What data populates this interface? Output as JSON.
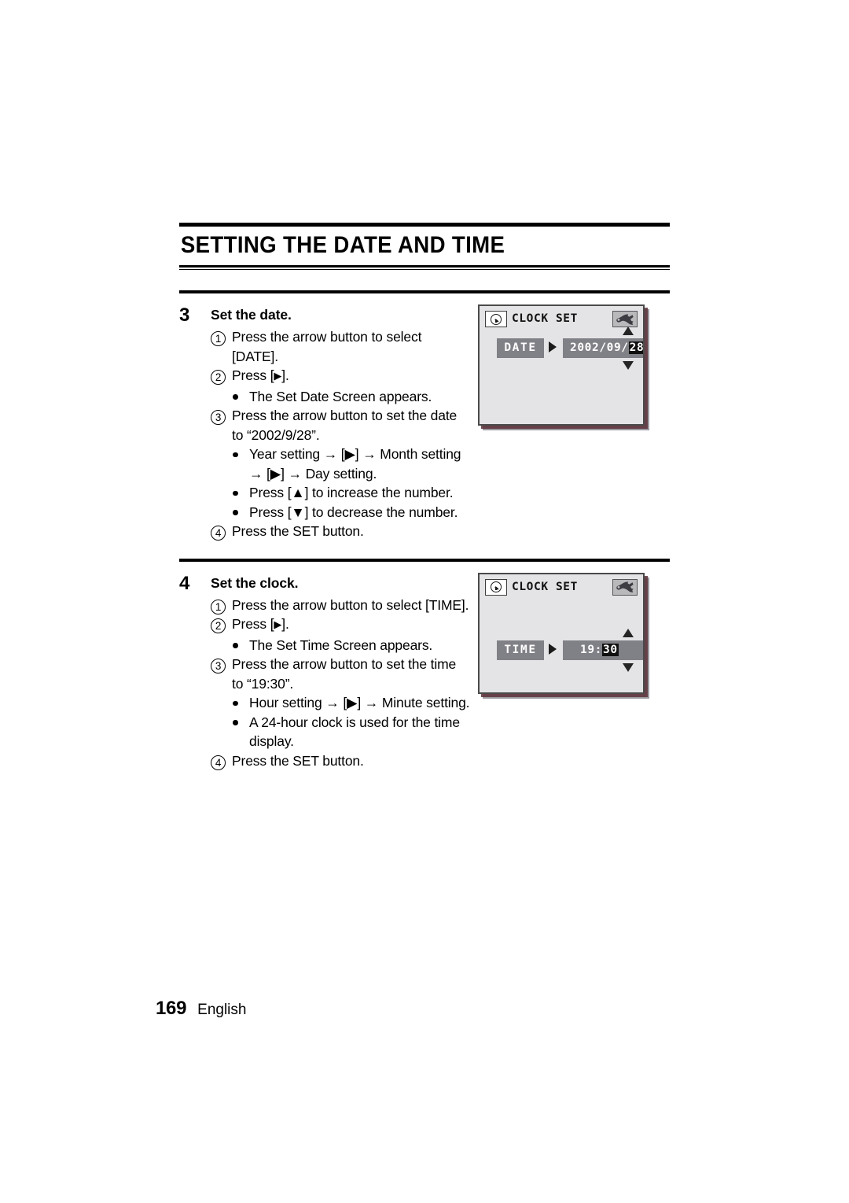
{
  "document": {
    "title": "SETTING THE DATE AND TIME",
    "footer": {
      "page_number": "169",
      "language": "English"
    }
  },
  "steps": [
    {
      "number": "3",
      "heading": "Set the date.",
      "items": [
        {
          "marker": "1",
          "marker_type": "circled",
          "text": "Press the arrow button to select [DATE]."
        },
        {
          "marker": "2",
          "marker_type": "circled",
          "text_pre": "Press [",
          "text_post": "].",
          "has_right_triangle": true
        },
        {
          "marker": "bullet",
          "marker_type": "bullet",
          "text": "The Set Date Screen appears."
        },
        {
          "marker": "3",
          "marker_type": "circled",
          "text": "Press the arrow button to set the date to “2002/9/28”."
        },
        {
          "marker": "bullet",
          "marker_type": "bullet",
          "text": "Year setting → [▶] → Month setting → [▶] → Day setting."
        },
        {
          "marker": "bullet",
          "marker_type": "bullet",
          "text": "Press [▲] to increase the number."
        },
        {
          "marker": "bullet",
          "marker_type": "bullet",
          "text": "Press [▼] to decrease the number."
        },
        {
          "marker": "4",
          "marker_type": "circled",
          "text": "Press the SET button."
        }
      ],
      "screen": {
        "title": "CLOCK SET",
        "clock_icon": "clock-icon",
        "tool_icon": "wrench-icon",
        "row_label": "DATE",
        "value_prefix": "2002/09/",
        "value_highlight": "28"
      }
    },
    {
      "number": "4",
      "heading": "Set the clock.",
      "items": [
        {
          "marker": "1",
          "marker_type": "circled",
          "text": "Press the arrow button to select [TIME]."
        },
        {
          "marker": "2",
          "marker_type": "circled",
          "text_pre": "Press [",
          "text_post": "].",
          "has_right_triangle": true
        },
        {
          "marker": "bullet",
          "marker_type": "bullet",
          "text": "The Set Time Screen appears."
        },
        {
          "marker": "3",
          "marker_type": "circled",
          "text": "Press the arrow button to set the time to “19:30”."
        },
        {
          "marker": "bullet",
          "marker_type": "bullet",
          "text": "Hour setting → [▶] → Minute setting."
        },
        {
          "marker": "bullet",
          "marker_type": "bullet",
          "text": "A 24-hour clock is used for the time display."
        },
        {
          "marker": "4",
          "marker_type": "circled",
          "text": "Press the SET button."
        }
      ],
      "screen": {
        "title": "CLOCK SET",
        "clock_icon": "clock-icon",
        "tool_icon": "wrench-icon",
        "row_label": "TIME",
        "value_prefix": "19:",
        "value_highlight": "30"
      }
    }
  ],
  "colors": {
    "lcd_background": "#e4e4e6",
    "lcd_border": "#4a4a4a",
    "field_gray": "#808087",
    "highlight_black": "#101010",
    "text": "#000000"
  }
}
